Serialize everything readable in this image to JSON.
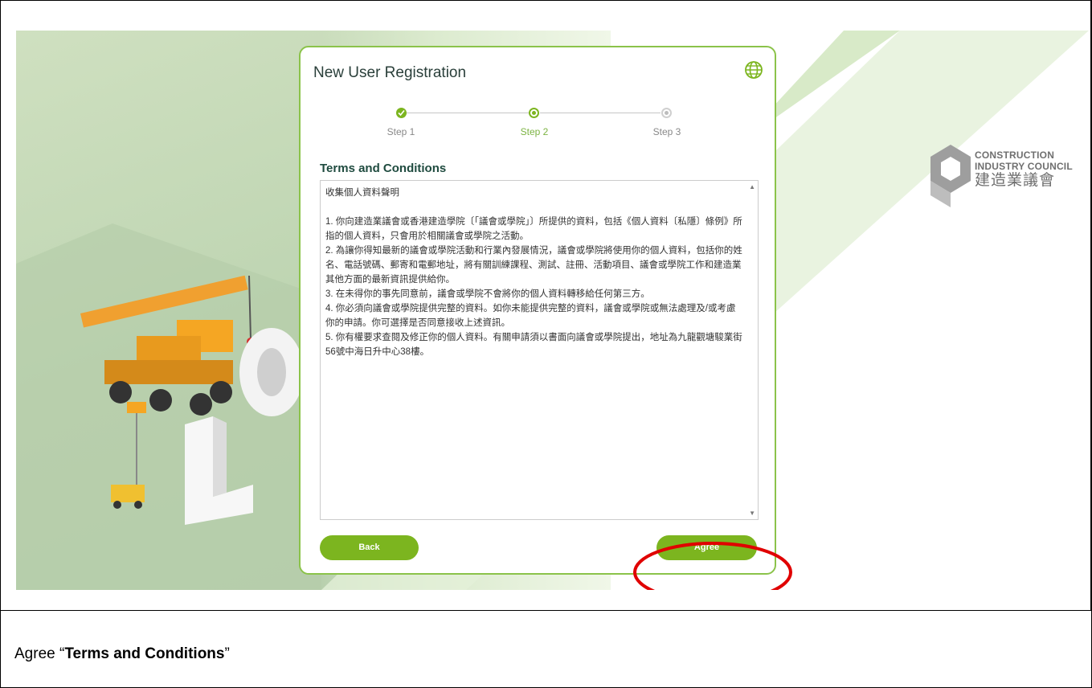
{
  "registration": {
    "title": "New User Registration",
    "steps": [
      {
        "label": "Step 1",
        "state": "completed"
      },
      {
        "label": "Step 2",
        "state": "active"
      },
      {
        "label": "Step 3",
        "state": "pending"
      }
    ],
    "terms_title": "Terms and Conditions",
    "terms_heading": "收集個人資料聲明",
    "terms_items": [
      "1. 你向建造業議會或香港建造學院〔「議會或學院」〕所提供的資料，包括《個人資料〔私隱〕條例》所指的個人資料，只會用於相關議會或學院之活動。",
      "2. 為讓你得知最新的議會或學院活動和行業內發展情況，議會或學院將使用你的個人資料，包括你的姓名、電話號碼、郵寄和電郵地址，將有關訓練課程、測試、註冊、活動項目、議會或學院工作和建造業其他方面的最新資訊提供給你。",
      "3. 在未得你的事先同意前，議會或學院不會將你的個人資料轉移給任何第三方。",
      "4. 你必須向議會或學院提供完整的資料。如你未能提供完整的資料，議會或學院或無法處理及/或考慮你的申請。你可選擇是否同意接收上述資訊。",
      "5. 你有權要求查閱及修正你的個人資料。有關申請須以書面向議會或學院提出，地址為九龍觀塘駿業街56號中海日升中心38樓。"
    ],
    "back_label": "Back",
    "agree_label": "Agree"
  },
  "logo": {
    "line1": "CONSTRUCTION",
    "line2": "INDUSTRY COUNCIL",
    "line3": "建造業議會"
  },
  "caption": {
    "prefix": "Agree “",
    "bold": "Terms and Conditions",
    "suffix": "”"
  },
  "icons": {
    "language": "globe-icon",
    "step_completed": "check-icon",
    "scroll_up": "arrow-up-icon",
    "scroll_down": "arrow-down-icon"
  },
  "colors": {
    "accent": "#7cb51f",
    "card_border": "#8bc34a",
    "heading": "#1f4b3f",
    "highlight": "#e00000"
  }
}
